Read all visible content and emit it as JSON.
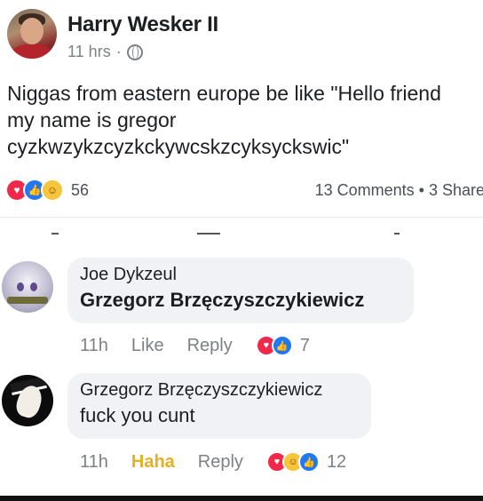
{
  "post": {
    "author": "Harry Wesker II",
    "time": "11 hrs",
    "time_separator": "·",
    "privacy_icon": "globe-icon",
    "text_lines": [
      "Niggas from eastern europe be like \"Hello friend",
      "my name is gregor",
      "cyzkwzykzcyzkckywcskzcyksyckswic\""
    ],
    "reaction_icons": [
      "love-icon",
      "like-icon",
      "haha-icon"
    ],
    "reaction_count": "56",
    "engagement": "13 Comments • 3 Share"
  },
  "comments": [
    {
      "author": "Joe Dykzeul",
      "text": "Grzegorz Brzęczyszczykiewicz",
      "time": "11h",
      "like_label": "Like",
      "reply_label": "Reply",
      "reaction_icons": [
        "love-icon",
        "like-icon"
      ],
      "reaction_count": "7"
    },
    {
      "author": "Grzegorz Brzęczyszczykiewicz",
      "text": "fuck you cunt",
      "time": "11h",
      "like_label": "Haha",
      "reply_label": "Reply",
      "reaction_icons": [
        "love-icon",
        "haha-icon",
        "like-icon"
      ],
      "reaction_count": "12"
    }
  ],
  "colors": {
    "love": "#f0284a",
    "like": "#2078f4",
    "haha": "#f7c53b",
    "haha_label": "#e4b022",
    "meta_gray": "#7d8085",
    "bubble": "#f0f2f5"
  }
}
